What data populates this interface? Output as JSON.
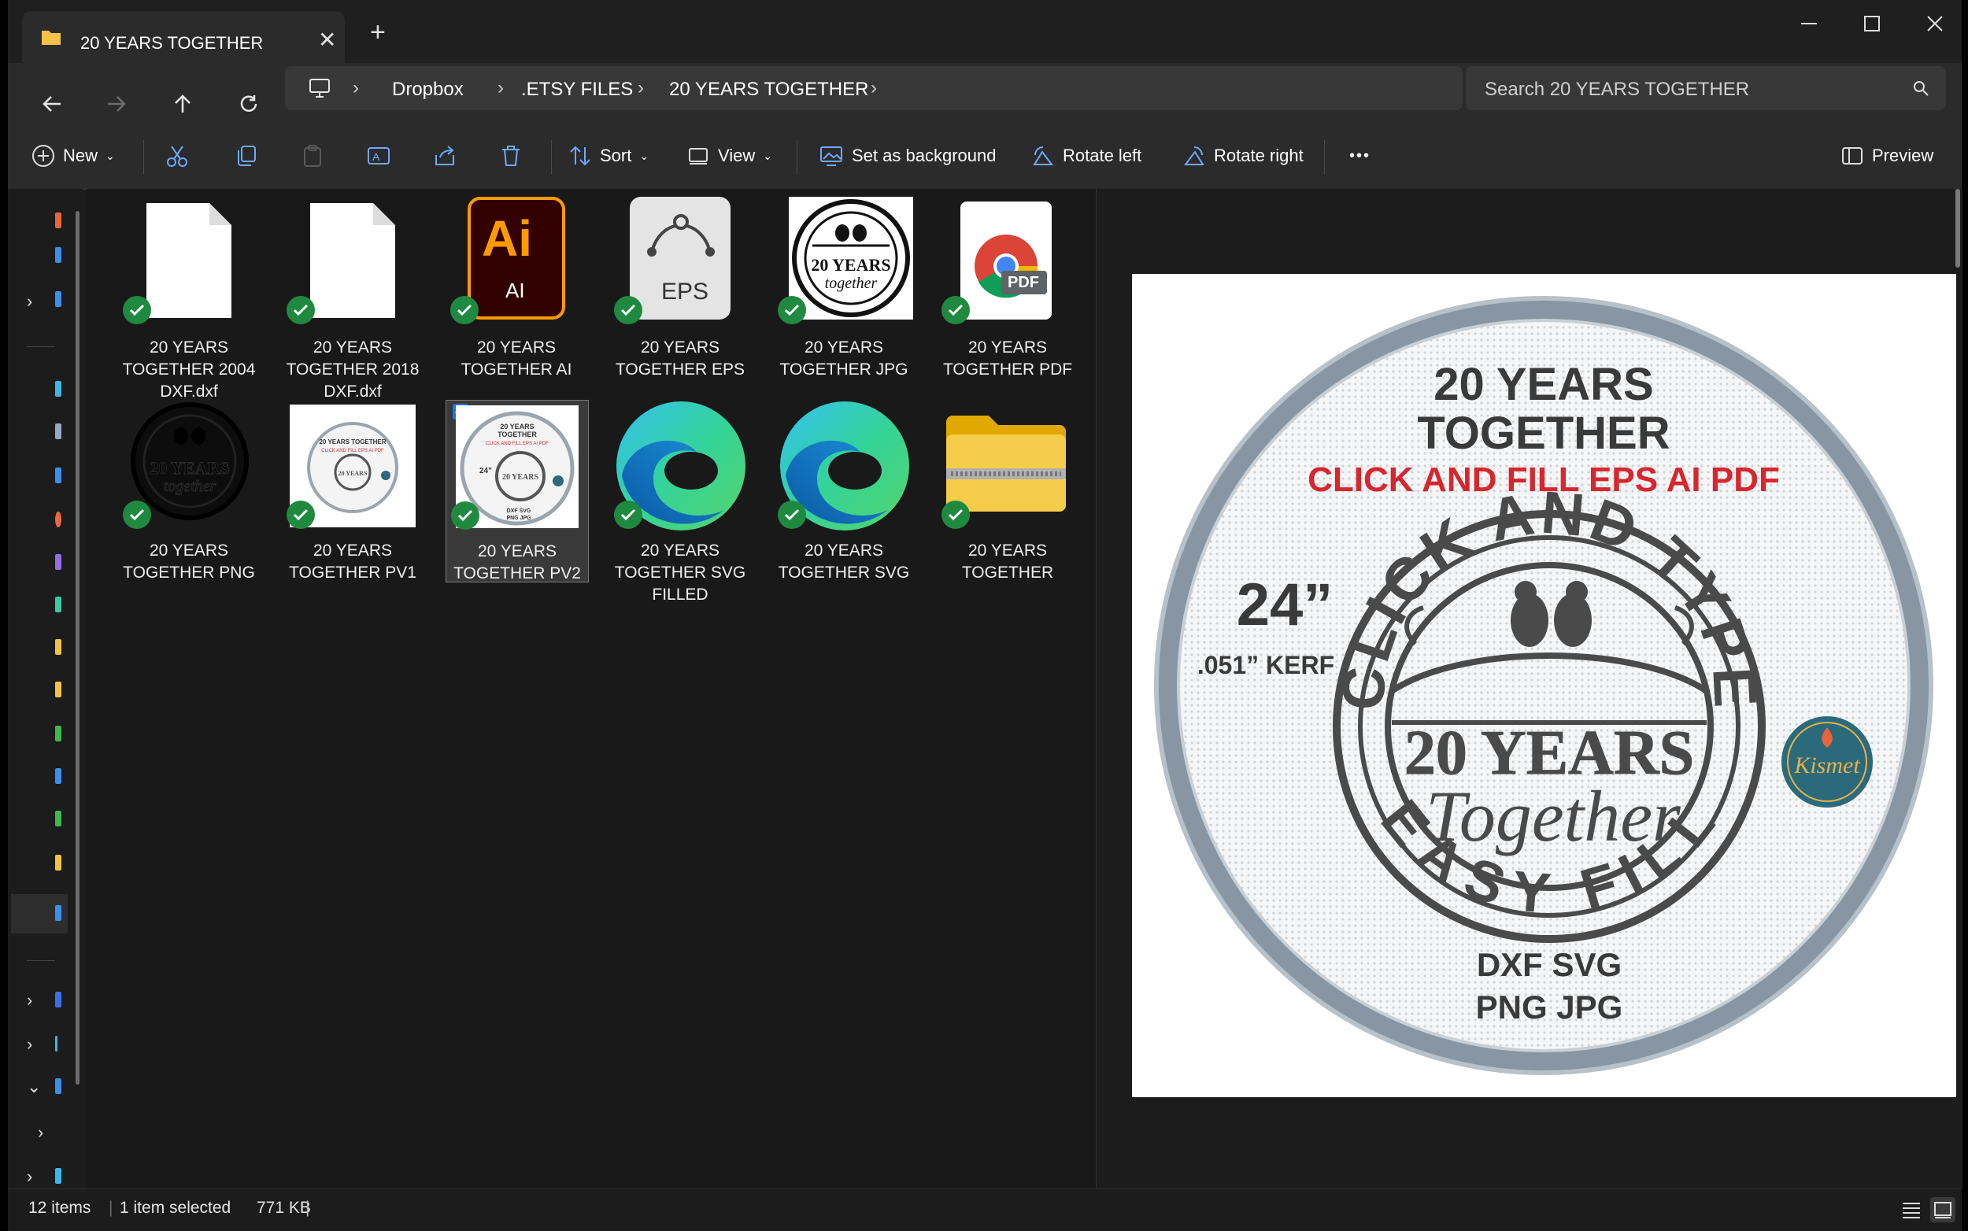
{
  "tab": {
    "title": "20 YEARS TOGETHER"
  },
  "address": {
    "crumbs": [
      "Dropbox",
      ".ETSY FILES",
      "20 YEARS TOGETHER"
    ]
  },
  "search": {
    "placeholder": "Search 20 YEARS TOGETHER"
  },
  "toolbar": {
    "new_label": "New",
    "sort_label": "Sort",
    "view_label": "View",
    "set_bg_label": "Set as background",
    "rotate_left_label": "Rotate left",
    "rotate_right_label": "Rotate right",
    "more_label": "•••",
    "preview_label": "Preview"
  },
  "files": [
    {
      "name": "20 YEARS TOGETHER 2004 DXF.dxf",
      "icon": "blank-file-icon"
    },
    {
      "name": "20 YEARS TOGETHER 2018 DXF.dxf",
      "icon": "blank-file-icon"
    },
    {
      "name": "20 YEARS TOGETHER AI",
      "icon": "illustrator-icon"
    },
    {
      "name": "20 YEARS TOGETHER EPS",
      "icon": "eps-file-icon"
    },
    {
      "name": "20 YEARS TOGETHER JPG",
      "icon": "jpg-thumbnail"
    },
    {
      "name": "20 YEARS TOGETHER PDF",
      "icon": "pdf-file-icon"
    },
    {
      "name": "20 YEARS TOGETHER PNG",
      "icon": "png-thumbnail"
    },
    {
      "name": "20 YEARS TOGETHER PV1",
      "icon": "pv1-thumbnail"
    },
    {
      "name": "20 YEARS TOGETHER PV2",
      "icon": "pv2-thumbnail"
    },
    {
      "name": "20 YEARS TOGETHER SVG FILLED",
      "icon": "edge-icon"
    },
    {
      "name": "20 YEARS TOGETHER SVG",
      "icon": "edge-icon"
    },
    {
      "name": "20 YEARS TOGETHER",
      "icon": "zip-folder-icon"
    }
  ],
  "icon_text": {
    "ai_big": "Ai",
    "ai_small": "AI",
    "eps": "EPS",
    "pdf": "PDF"
  },
  "preview": {
    "title1": "20 YEARS",
    "title2": "TOGETHER",
    "subtitle": "CLICK AND FILL EPS AI PDF",
    "size": "24”",
    "kerf": ".051” KERF",
    "ring_top": "CLICK AND TYPE",
    "ring_bottom": "EASY FILL",
    "inner1": "20 YEARS",
    "inner2": "Together",
    "formats1": "DXF SVG",
    "formats2": "PNG JPG",
    "badge": "Kismet",
    "accent": "#d7262e"
  },
  "status": {
    "count": "12 items",
    "selected": "1 item selected",
    "size": "771 KB"
  },
  "colors": {
    "check": "#1f8a3f",
    "bg": "#1c1c1c"
  }
}
